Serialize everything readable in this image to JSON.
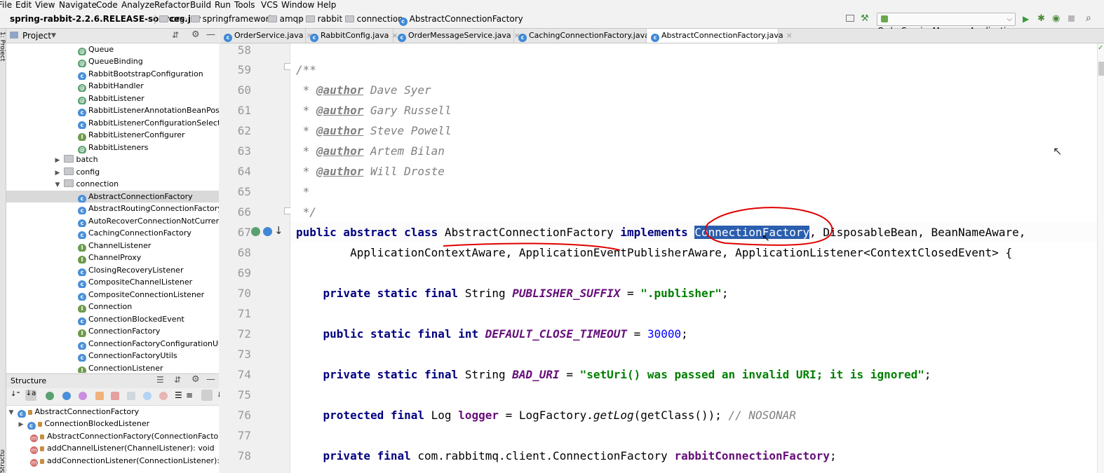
{
  "menu": [
    "File",
    "Edit",
    "View",
    "Navigate",
    "Code",
    "Analyze",
    "Refactor",
    "Build",
    "Run",
    "Tools",
    "VCS",
    "Window",
    "Help"
  ],
  "breadcrumb": [
    "spring-rabbit-2.2.6.RELEASE-sources.jar",
    "org",
    "springframework",
    "amqp",
    "rabbit",
    "connection",
    "AbstractConnectionFactory"
  ],
  "run_config": "OrderServiceManagerApplication",
  "left_stripe_label": "1: Project",
  "left_stripe_bottom_label": "Structure",
  "project": {
    "title": "Project",
    "items": [
      {
        "label": "Queue",
        "icon": "a"
      },
      {
        "label": "QueueBinding",
        "icon": "a"
      },
      {
        "label": "RabbitBootstrapConfiguration",
        "icon": "c"
      },
      {
        "label": "RabbitHandler",
        "icon": "a"
      },
      {
        "label": "RabbitListener",
        "icon": "a"
      },
      {
        "label": "RabbitListenerAnnotationBeanPostProc",
        "icon": "c"
      },
      {
        "label": "RabbitListenerConfigurationSelector",
        "icon": "c"
      },
      {
        "label": "RabbitListenerConfigurer",
        "icon": "i"
      },
      {
        "label": "RabbitListeners",
        "icon": "a"
      },
      {
        "label": "batch",
        "icon": "folder"
      },
      {
        "label": "config",
        "icon": "folder"
      },
      {
        "label": "connection",
        "icon": "folder-open"
      },
      {
        "label": "AbstractConnectionFactory",
        "icon": "c"
      },
      {
        "label": "AbstractRoutingConnectionFactory",
        "icon": "c"
      },
      {
        "label": "AutoRecoverConnectionNotCurrentlyO",
        "icon": "c"
      },
      {
        "label": "CachingConnectionFactory",
        "icon": "c"
      },
      {
        "label": "ChannelListener",
        "icon": "i"
      },
      {
        "label": "ChannelProxy",
        "icon": "i"
      },
      {
        "label": "ClosingRecoveryListener",
        "icon": "c"
      },
      {
        "label": "CompositeChannelListener",
        "icon": "c"
      },
      {
        "label": "CompositeConnectionListener",
        "icon": "c"
      },
      {
        "label": "Connection",
        "icon": "i"
      },
      {
        "label": "ConnectionBlockedEvent",
        "icon": "c"
      },
      {
        "label": "ConnectionFactory",
        "icon": "i"
      },
      {
        "label": "ConnectionFactoryConfigurationUtils",
        "icon": "c"
      },
      {
        "label": "ConnectionFactoryUtils",
        "icon": "c"
      },
      {
        "label": "ConnectionListener",
        "icon": "i"
      }
    ]
  },
  "structure": {
    "title": "Structure",
    "items": [
      "AbstractConnectionFactory",
      "ConnectionBlockedListener",
      "AbstractConnectionFactory(ConnectionFactory)",
      "addChannelListener(ChannelListener): void",
      "addConnectionListener(ConnectionListener): void"
    ]
  },
  "tabs": [
    {
      "label": "OrderService.java",
      "active": false
    },
    {
      "label": "RabbitConfig.java",
      "active": false
    },
    {
      "label": "OrderMessageService.java",
      "active": false
    },
    {
      "label": "CachingConnectionFactory.java",
      "active": false
    },
    {
      "label": "AbstractConnectionFactory.java",
      "active": true
    }
  ],
  "editor": {
    "line_numbers": [
      "58",
      "59",
      "60",
      "61",
      "62",
      "63",
      "64",
      "65",
      "66",
      "67",
      "68",
      "69",
      "70",
      "71",
      "72",
      "73",
      "74",
      "75",
      "76",
      "77",
      "78"
    ],
    "c59": "/**",
    "author_tag": "@author",
    "authors": [
      " Dave Syer",
      " Gary Russell",
      " Steve Powell",
      " Artem Bilan",
      " Will Droste"
    ],
    "star": " * ",
    "c65": " *",
    "c66": " */",
    "l67": {
      "kw1": "public abstract class",
      "cls": " AbstractConnectionFactory ",
      "kw2": "implements",
      "hl": "ConnectionFactory",
      "rest": ", DisposableBean, BeanNameAware,"
    },
    "l68": "        ApplicationContextAware, ApplicationEventPublisherAware, ApplicationListener<ContextClosedEvent> {",
    "l70": {
      "kw": "private static final",
      "type": " String ",
      "name": "PUBLISHER_SUFFIX",
      "eq": " = ",
      "val": "\".publisher\"",
      "end": ";"
    },
    "l72": {
      "kw": "public static final int",
      "sp": " ",
      "name": "DEFAULT_CLOSE_TIMEOUT",
      "eq": " = ",
      "val": "30000",
      "end": ";"
    },
    "l74": {
      "kw": "private static final",
      "type": " String ",
      "name": "BAD_URI",
      "eq": " = ",
      "val": "\"setUri() was passed an invalid URI; it is ignored\"",
      "end": ";"
    },
    "l76": {
      "kw": "protected final",
      "type": " Log ",
      "name": "logger",
      "eq": " = LogFactory.",
      "method": "getLog",
      "args": "(getClass()); ",
      "comment": "// NOSONAR"
    },
    "l78": {
      "kw": "private final",
      "type": " com.rabbitmq.client.ConnectionFactory ",
      "name": "rabbitConnectionFactory",
      "end": ";"
    }
  }
}
